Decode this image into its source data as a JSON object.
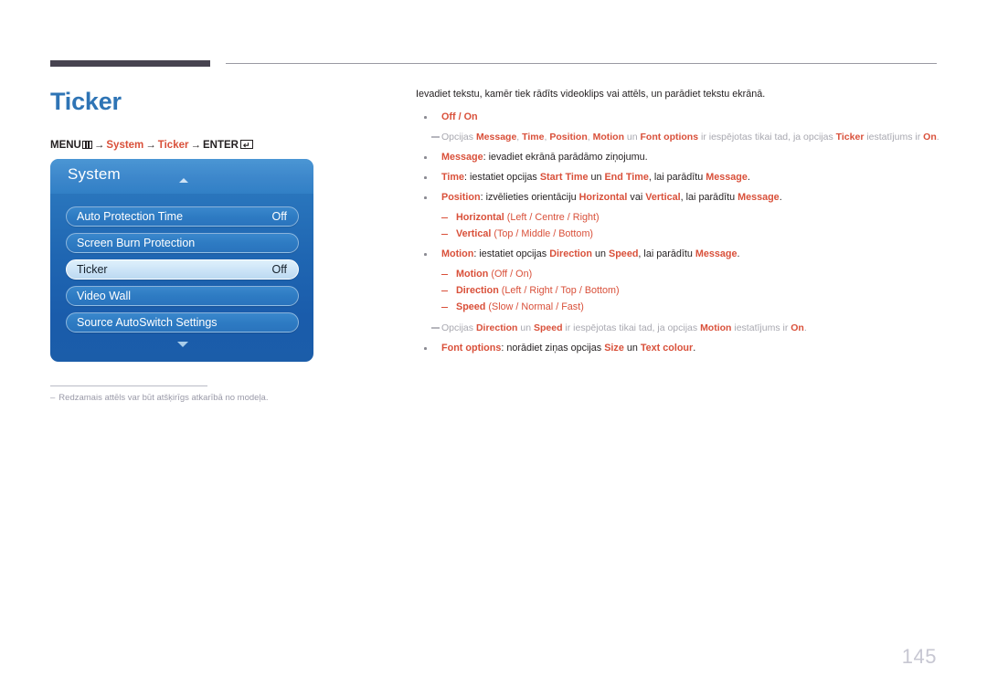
{
  "header": {
    "rule_color": "#474350",
    "line_color": "#9a9aa2"
  },
  "page_title": "Ticker",
  "breadcrumb": {
    "menu_label": "MENU",
    "menu_icon": "menu-grid-icon",
    "arrow": "→",
    "step1": "System",
    "step2": "Ticker",
    "enter_label": "ENTER",
    "enter_icon": "enter-key-icon",
    "enter_glyph": "↵"
  },
  "osd": {
    "title": "System",
    "up_arrow_icon": "chevron-up-icon",
    "down_arrow_icon": "chevron-down-icon",
    "rows": [
      {
        "label": "Auto Protection Time",
        "value": "Off",
        "selected": false
      },
      {
        "label": "Screen Burn Protection",
        "value": "",
        "selected": false
      },
      {
        "label": "Ticker",
        "value": "Off",
        "selected": true
      },
      {
        "label": "Video Wall",
        "value": "",
        "selected": false
      },
      {
        "label": "Source AutoSwitch Settings",
        "value": "",
        "selected": false
      }
    ]
  },
  "footnote": {
    "dash": "–",
    "text": "Redzamais attēls var būt atšķirīgs atkarībā no modeļa."
  },
  "content": {
    "intro": "Ievadiet tekstu, kamēr tiek rādīts videoklips vai attēls, un parādiet tekstu ekrānā.",
    "b1": "Off / On",
    "note1_p1": "Opcijas ",
    "note1_m": "Message",
    "note1_c1": ", ",
    "note1_t": "Time",
    "note1_c2": ", ",
    "note1_p": "Position",
    "note1_c3": ", ",
    "note1_mo": "Motion",
    "note1_un": " un ",
    "note1_fo": "Font options",
    "note1_mid": " ir iespējotas tikai tad, ja opcijas ",
    "note1_tk": "Ticker",
    "note1_end": " iestatījums ir ",
    "note1_on": "On",
    "note1_dot": ".",
    "b2_key": "Message",
    "b2_rest": ": ievadiet ekrānā parādāmo ziņojumu.",
    "b3_key": "Time",
    "b3_t1": ": iestatiet opcijas ",
    "b3_k2": "Start Time",
    "b3_t2": " un ",
    "b3_k3": "End Time",
    "b3_t3": ", lai parādītu ",
    "b3_k4": "Message",
    "b3_t4": ".",
    "b4_key": "Position",
    "b4_t1": ": izvēlieties orientāciju ",
    "b4_k2": "Horizontal",
    "b4_t2": " vai ",
    "b4_k3": "Vertical",
    "b4_t3": ", lai parādītu ",
    "b4_k4": "Message",
    "b4_t4": ".",
    "s1_key": "Horizontal",
    "s1_opts": " (Left / Centre / Right)",
    "s2_key": "Vertical",
    "s2_opts": " (Top / Middle / Bottom)",
    "b5_key": "Motion",
    "b5_t1": ": iestatiet opcijas ",
    "b5_k2": "Direction",
    "b5_t2": " un ",
    "b5_k3": "Speed",
    "b5_t3": ", lai parādītu ",
    "b5_k4": "Message",
    "b5_t4": ".",
    "s3_key": "Motion",
    "s3_opts": " (Off / On)",
    "s4_key": "Direction",
    "s4_opts": " (Left / Right / Top / Bottom)",
    "s5_key": "Speed",
    "s5_opts": " (Slow / Normal / Fast)",
    "note2_p1": "Opcijas ",
    "note2_d": "Direction",
    "note2_un": " un ",
    "note2_s": "Speed",
    "note2_mid": " ir iespējotas tikai tad, ja opcijas ",
    "note2_mo": "Motion",
    "note2_end": " iestatījums ir ",
    "note2_on": "On",
    "note2_dot": ".",
    "b6_key": "Font options",
    "b6_t1": ": norādiet ziņas opcijas ",
    "b6_k2": "Size",
    "b6_t2": " un ",
    "b6_k3": "Text colour",
    "b6_t3": "."
  },
  "page_number": "145",
  "colors": {
    "accent_orange": "#d9503a",
    "title_blue": "#2e74b5",
    "osd_blue": "#1f66b2",
    "muted_grey": "#a8a8b0"
  }
}
